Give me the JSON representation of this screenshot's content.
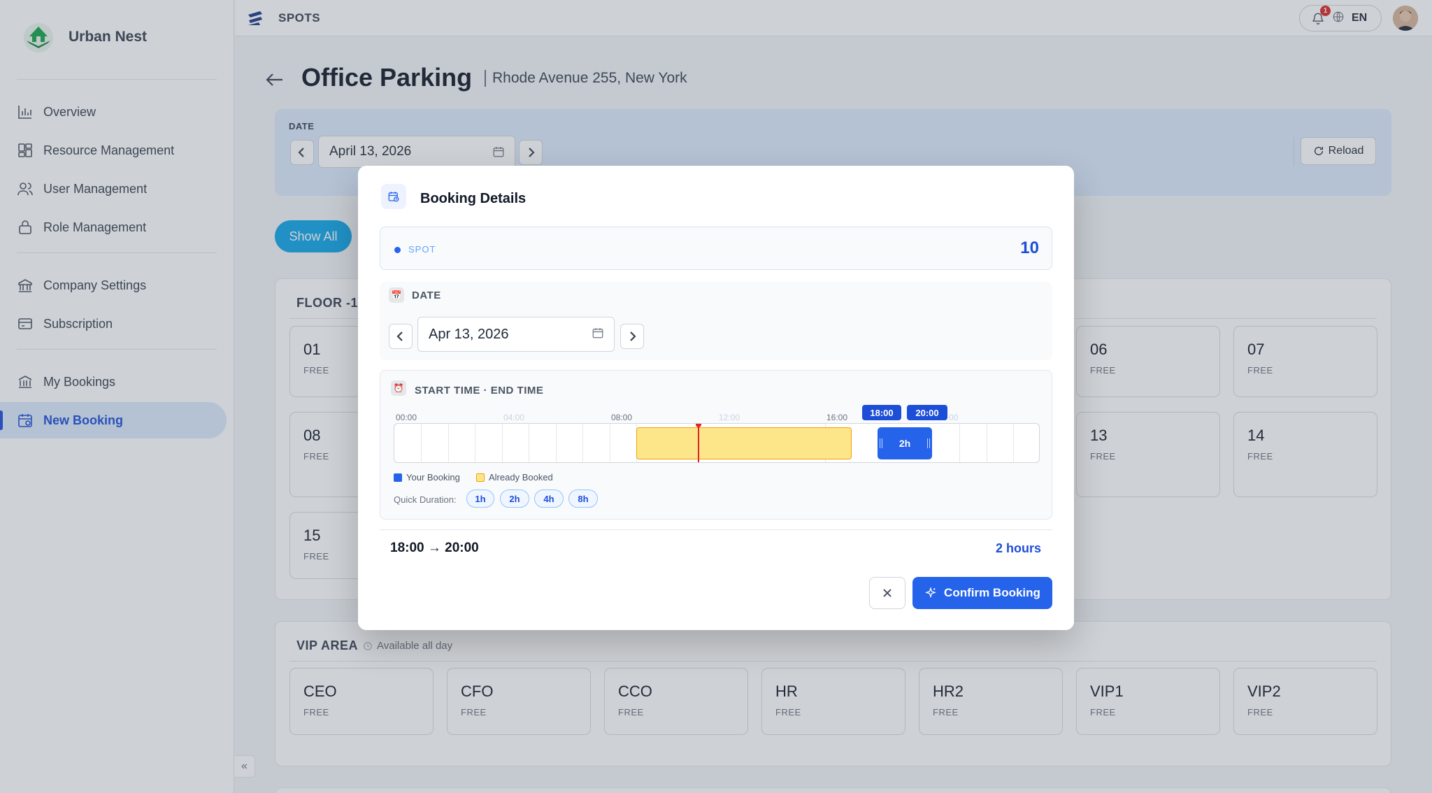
{
  "sidebar": {
    "brand": "Urban Nest",
    "items": [
      {
        "label": "Overview",
        "icon": "bar-chart-icon"
      },
      {
        "label": "Resource Management",
        "icon": "grid-icon"
      },
      {
        "label": "User Management",
        "icon": "users-icon"
      },
      {
        "label": "Role Management",
        "icon": "lock-icon"
      },
      {
        "label": "Company Settings",
        "icon": "building-icon"
      },
      {
        "label": "Subscription",
        "icon": "credit-card-icon"
      },
      {
        "label": "My Bookings",
        "icon": "bank-icon"
      },
      {
        "label": "New Booking",
        "icon": "calendar-icon",
        "active": true
      }
    ],
    "collapse_glyph": "«"
  },
  "topbar": {
    "title": "SPOTS",
    "notifications": "1",
    "language": "EN"
  },
  "page": {
    "title": "Office Parking",
    "subtitle": "Rhode Avenue 255, New York",
    "date_label": "DATE",
    "date_value": "April 13, 2026",
    "reload_label": "Reload",
    "show_all_label": "Show All"
  },
  "floor": {
    "title": "FLOOR -1",
    "spots": [
      {
        "name": "01",
        "status": "FREE"
      },
      {
        "name": "06",
        "status": "FREE"
      },
      {
        "name": "07",
        "status": "FREE"
      },
      {
        "name": "08",
        "status": "FREE"
      },
      {
        "name": "13",
        "status": "FREE"
      },
      {
        "name": "14",
        "status": "FREE"
      },
      {
        "name": "15",
        "status": "FREE"
      }
    ]
  },
  "vip": {
    "title": "VIP AREA",
    "note": "Available all day",
    "spots": [
      {
        "name": "CEO",
        "status": "FREE"
      },
      {
        "name": "CFO",
        "status": "FREE"
      },
      {
        "name": "CCO",
        "status": "FREE"
      },
      {
        "name": "HR",
        "status": "FREE"
      },
      {
        "name": "HR2",
        "status": "FREE"
      },
      {
        "name": "VIP1",
        "status": "FREE"
      },
      {
        "name": "VIP2",
        "status": "FREE"
      }
    ]
  },
  "modal": {
    "title": "Booking Details",
    "spot_label": "SPOT",
    "spot_value": "10",
    "date_label": "DATE",
    "date_value": "Apr 13, 2026",
    "time_label": "START TIME · END TIME",
    "ticks": [
      "00:00",
      "04:00",
      "08:00",
      "12:00",
      "16:00",
      "00"
    ],
    "start_badge": "18:00",
    "end_badge": "20:00",
    "selection_label": "2h",
    "legend_mine": "Your Booking",
    "legend_booked": "Already Booked",
    "quick_label": "Quick Duration:",
    "quick_options": [
      "1h",
      "2h",
      "4h",
      "8h"
    ],
    "summary_range": "18:00 → 20:00",
    "summary_hours": "2 hours",
    "confirm_label": "Confirm Booking",
    "colors": {
      "mine": "#2563eb",
      "booked": "#fde68a",
      "now": "#dc2626"
    }
  }
}
